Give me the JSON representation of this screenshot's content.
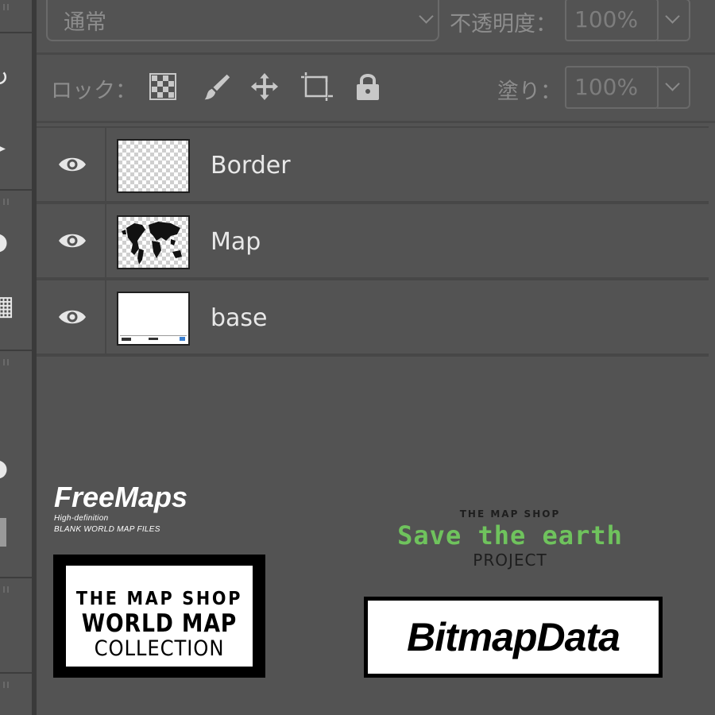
{
  "blend": {
    "mode": "通常"
  },
  "opacity": {
    "label": "不透明度：",
    "value": "100%"
  },
  "lock": {
    "label": "ロック："
  },
  "fill": {
    "label": "塗り：",
    "value": "100%"
  },
  "layers": [
    {
      "name": "Border",
      "thumb": "transparent"
    },
    {
      "name": "Map",
      "thumb": "world-map"
    },
    {
      "name": "base",
      "thumb": "white"
    }
  ],
  "logos": {
    "freemaps": {
      "title": "FreeMaps",
      "sub1": "High-definition",
      "sub2": "BLANK WORLD MAP FILES"
    },
    "mapshop": {
      "line1": "THE MAP SHOP",
      "line2": "WORLD MAP",
      "line3": "COLLECTION"
    },
    "earth": {
      "kicker": "THE MAP SHOP",
      "main": "Save the earth",
      "project": "PROJECT",
      "accent": "#6fc35d"
    },
    "bitmap": {
      "text": "BitmapData"
    }
  },
  "icons": [
    "eye-icon",
    "lock-transparent-pixels-icon",
    "lock-image-pixels-icon",
    "lock-position-icon",
    "lock-artboard-icon",
    "lock-all-icon"
  ]
}
